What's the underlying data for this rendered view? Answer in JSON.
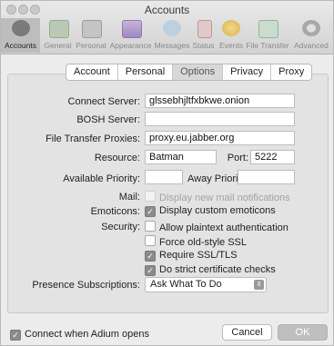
{
  "window": {
    "title": "Accounts"
  },
  "toolbar": {
    "items": [
      {
        "label": "Accounts",
        "icon": "accounts-icon"
      },
      {
        "label": "General",
        "icon": "general-icon"
      },
      {
        "label": "Personal",
        "icon": "personal-icon"
      },
      {
        "label": "Appearance",
        "icon": "appearance-icon"
      },
      {
        "label": "Messages",
        "icon": "messages-icon"
      },
      {
        "label": "Status",
        "icon": "status-icon"
      },
      {
        "label": "Events",
        "icon": "events-icon"
      },
      {
        "label": "File Transfer",
        "icon": "file-transfer-icon"
      },
      {
        "label": "Advanced",
        "icon": "advanced-icon"
      }
    ],
    "selected": "Accounts"
  },
  "tabs": {
    "items": [
      "Account",
      "Personal",
      "Options",
      "Privacy",
      "Proxy"
    ],
    "selected": "Options"
  },
  "form": {
    "connect_server_label": "Connect Server:",
    "connect_server_value": "glssebhjltfxbkwe.onion",
    "bosh_server_label": "BOSH Server:",
    "bosh_server_value": "",
    "file_transfer_proxies_label": "File Transfer Proxies:",
    "file_transfer_proxies_value": "proxy.eu.jabber.org",
    "resource_label": "Resource:",
    "resource_value": "Batman",
    "port_label": "Port:",
    "port_value": "5222",
    "available_priority_label": "Available Priority:",
    "available_priority_value": "",
    "away_priority_label": "Away Priority:",
    "away_priority_value": "",
    "mail_label": "Mail:",
    "mail_option": "Display new mail notifications",
    "emoticons_label": "Emoticons:",
    "emoticons_option": "Display custom emoticons",
    "security_label": "Security:",
    "security_options": [
      {
        "label": "Allow plaintext authentication",
        "checked": false
      },
      {
        "label": "Force old-style SSL",
        "checked": false
      },
      {
        "label": "Require SSL/TLS",
        "checked": true
      },
      {
        "label": "Do strict certificate checks",
        "checked": true
      }
    ],
    "presence_label": "Presence Subscriptions:",
    "presence_value": "Ask What To Do"
  },
  "footer": {
    "connect_when_opens_label": "Connect when Adium opens",
    "connect_when_opens_checked": true,
    "cancel_label": "Cancel",
    "ok_label": "OK"
  }
}
